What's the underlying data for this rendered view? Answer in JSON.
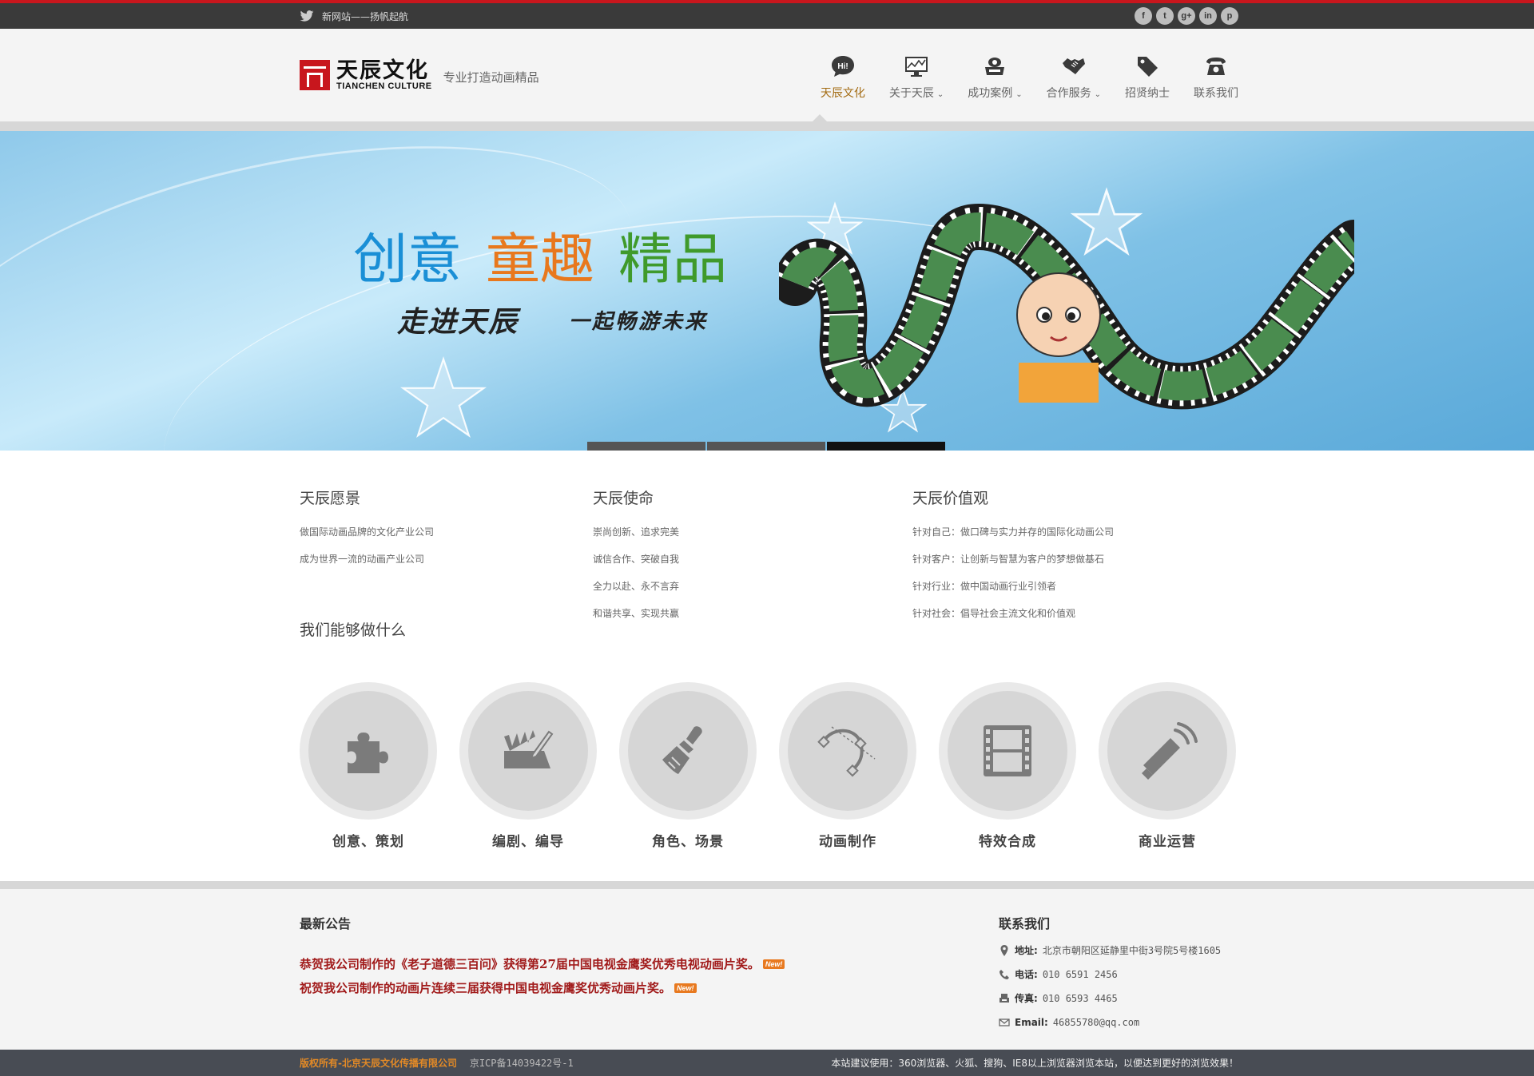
{
  "topbar": {
    "tagline": "新网站——扬帆起航",
    "social": [
      "f",
      "t",
      "g+",
      "in",
      "p"
    ]
  },
  "header": {
    "logo_cn": "天辰文化",
    "logo_en": "TIANCHEN CULTURE",
    "slogan": "专业打造动画精品",
    "nav": [
      {
        "label": "天辰文化",
        "icon": "speech-bubble-hi-icon",
        "active": true,
        "has_caret": false
      },
      {
        "label": "关于天辰",
        "icon": "monitor-chart-icon",
        "has_caret": true
      },
      {
        "label": "成功案例",
        "icon": "cloud-tray-icon",
        "has_caret": true
      },
      {
        "label": "合作服务",
        "icon": "handshake-icon",
        "has_caret": true
      },
      {
        "label": "招贤纳士",
        "icon": "tag-icon",
        "has_caret": false
      },
      {
        "label": "联系我们",
        "icon": "telephone-icon",
        "has_caret": false
      }
    ],
    "hi_badge": "Hi!"
  },
  "banner": {
    "headline": [
      "创意",
      "童趣",
      "精品"
    ],
    "headline_colors": [
      "#1a8fd6",
      "#e8781d",
      "#3f9a2b"
    ],
    "subline_1": "走进天辰",
    "subline_2": "一起畅游未来",
    "slides": 3,
    "active_slide": 3
  },
  "values": {
    "vision": {
      "title": "天辰愿景",
      "items": [
        "做国际动画品牌的文化产业公司",
        "成为世界一流的动画产业公司"
      ]
    },
    "mission": {
      "title": "天辰使命",
      "items": [
        "崇尚创新、追求完美",
        "诚信合作、突破自我",
        "全力以赴、永不言弃",
        "和谐共享、实现共赢"
      ]
    },
    "values": {
      "title": "天辰价值观",
      "items": [
        "针对自己：做口碑与实力并存的国际化动画公司",
        "针对客户：让创新与智慧为客户的梦想做基石",
        "针对行业：做中国动画行业引领者",
        "针对社会：倡导社会主流文化和价值观"
      ]
    }
  },
  "services": {
    "title": "我们能够做什么",
    "items": [
      {
        "label": "创意、策划",
        "icon": "puzzle-icon"
      },
      {
        "label": "编剧、编导",
        "icon": "clapper-pencil-icon"
      },
      {
        "label": "角色、场景",
        "icon": "paintbrush-icon"
      },
      {
        "label": "动画制作",
        "icon": "bezier-curve-icon"
      },
      {
        "label": "特效合成",
        "icon": "film-strip-icon"
      },
      {
        "label": "商业运营",
        "icon": "megaphone-icon"
      }
    ]
  },
  "notices": {
    "title": "最新公告",
    "items": [
      "恭贺我公司制作的《老子道德三百问》获得第27届中国电视金鹰奖优秀电视动画片奖。",
      "祝贺我公司制作的动画片连续三届获得中国电视金鹰奖优秀动画片奖。"
    ],
    "new_tag": "New!"
  },
  "contact": {
    "title": "联系我们",
    "address_label": "地址:",
    "address": "北京市朝阳区延静里中街3号院5号楼1605",
    "phone_label": "电话:",
    "phone": "010 6591 2456",
    "fax_label": "传真:",
    "fax": "010 6593 4465",
    "email_label": "Email:",
    "email": "46855780@qq.com"
  },
  "footer": {
    "copyright": "版权所有-北京天辰文化传播有限公司",
    "icp": "京ICP备14039422号-1",
    "tip": "本站建议使用：360浏览器、火狐、搜狗、IE8以上浏览器浏览本站，以便达到更好的浏览效果！"
  }
}
